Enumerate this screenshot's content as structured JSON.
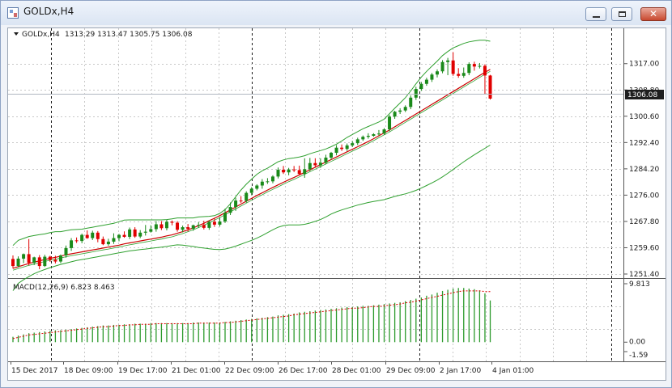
{
  "window": {
    "title": "GOLDx,H4"
  },
  "main_panel": {
    "info_prefix": "GOLDx,H4",
    "ohlc": "1313.29 1313.47 1305.75 1306.08",
    "current_price": "1306.08",
    "price_ticks": [
      "1317.00",
      "1308.80",
      "1300.60",
      "1292.40",
      "1284.20",
      "1276.00",
      "1267.80",
      "1259.60",
      "1251.40"
    ]
  },
  "macd_panel": {
    "label": "MACD(12,26,9) 6.823 8.463",
    "ticks": [
      "9.813",
      "0.00",
      "-1.59"
    ]
  },
  "time_axis": {
    "labels": [
      "15 Dec 2017",
      "18 Dec 09:00",
      "19 Dec 17:00",
      "21 Dec 01:00",
      "22 Dec 09:00",
      "26 Dec 17:00",
      "28 Dec 01:00",
      "29 Dec 09:00",
      "2 Jan 17:00",
      "4 Jan 01:00"
    ]
  },
  "colors": {
    "bull": "#1a8a1a",
    "bear": "#e00000",
    "band": "#2fa02f",
    "ma": "#cc0000",
    "macd_hist": "#2c9a2c",
    "signal": "#e00000"
  },
  "chart_data": [
    {
      "type": "candlestick",
      "symbol": "GOLDx",
      "timeframe": "H4",
      "ylim": [
        1251.4,
        1325
      ],
      "ticks": [
        1317.0,
        1308.8,
        1300.6,
        1292.4,
        1284.2,
        1276.0,
        1267.8,
        1259.6,
        1251.4
      ],
      "candles": [
        {
          "o": 1256.1,
          "h": 1257.2,
          "c": 1253.9,
          "l": 1253.1
        },
        {
          "o": 1253.9,
          "h": 1256.9,
          "c": 1256.2,
          "l": 1253.5
        },
        {
          "o": 1256.2,
          "h": 1257.8,
          "c": 1257.6,
          "l": 1254.8
        },
        {
          "o": 1257.6,
          "h": 1262.3,
          "c": 1254.9,
          "l": 1254.1
        },
        {
          "o": 1254.9,
          "h": 1256.8,
          "c": 1256.6,
          "l": 1254.2
        },
        {
          "o": 1256.6,
          "h": 1257.3,
          "c": 1253.9,
          "l": 1252.9
        },
        {
          "o": 1253.9,
          "h": 1257.4,
          "c": 1256.8,
          "l": 1253.6
        },
        {
          "o": 1256.8,
          "h": 1257.1,
          "c": 1255.8,
          "l": 1255.2
        },
        {
          "o": 1255.8,
          "h": 1257.1,
          "c": 1255.3,
          "l": 1254.7
        },
        {
          "o": 1255.3,
          "h": 1257.5,
          "c": 1257.2,
          "l": 1254.8
        },
        {
          "o": 1257.2,
          "h": 1260.3,
          "c": 1259.5,
          "l": 1256.5
        },
        {
          "o": 1259.5,
          "h": 1262.6,
          "c": 1261.9,
          "l": 1258.6
        },
        {
          "o": 1261.9,
          "h": 1262.8,
          "c": 1261.7,
          "l": 1261.1
        },
        {
          "o": 1261.7,
          "h": 1264.0,
          "c": 1263.6,
          "l": 1261.0
        },
        {
          "o": 1263.6,
          "h": 1265.0,
          "c": 1262.6,
          "l": 1262.4
        },
        {
          "o": 1262.6,
          "h": 1264.9,
          "c": 1264.3,
          "l": 1262.0
        },
        {
          "o": 1264.3,
          "h": 1264.8,
          "c": 1262.3,
          "l": 1261.3
        },
        {
          "o": 1262.3,
          "h": 1263.1,
          "c": 1260.7,
          "l": 1260.4
        },
        {
          "o": 1260.7,
          "h": 1262.4,
          "c": 1261.5,
          "l": 1260.2
        },
        {
          "o": 1261.5,
          "h": 1264.1,
          "c": 1262.6,
          "l": 1260.8
        },
        {
          "o": 1262.6,
          "h": 1263.9,
          "c": 1263.6,
          "l": 1261.6
        },
        {
          "o": 1263.6,
          "h": 1264.7,
          "c": 1263.0,
          "l": 1262.7
        },
        {
          "o": 1263.0,
          "h": 1265.9,
          "c": 1265.3,
          "l": 1262.3
        },
        {
          "o": 1265.3,
          "h": 1266.0,
          "c": 1263.1,
          "l": 1262.7
        },
        {
          "o": 1263.1,
          "h": 1265.1,
          "c": 1264.3,
          "l": 1262.6
        },
        {
          "o": 1264.3,
          "h": 1266.7,
          "c": 1264.6,
          "l": 1263.4
        },
        {
          "o": 1264.6,
          "h": 1266.6,
          "c": 1265.4,
          "l": 1264.3
        },
        {
          "o": 1265.4,
          "h": 1267.9,
          "c": 1266.9,
          "l": 1264.6
        },
        {
          "o": 1266.9,
          "h": 1267.9,
          "c": 1265.7,
          "l": 1265.1
        },
        {
          "o": 1265.7,
          "h": 1268.3,
          "c": 1267.7,
          "l": 1265.0
        },
        {
          "o": 1267.7,
          "h": 1268.1,
          "c": 1267.4,
          "l": 1266.6
        },
        {
          "o": 1267.4,
          "h": 1267.9,
          "c": 1265.2,
          "l": 1264.6
        },
        {
          "o": 1265.2,
          "h": 1266.5,
          "c": 1266.0,
          "l": 1264.4
        },
        {
          "o": 1266.0,
          "h": 1267.0,
          "c": 1265.5,
          "l": 1264.7
        },
        {
          "o": 1265.5,
          "h": 1266.8,
          "c": 1266.6,
          "l": 1264.9
        },
        {
          "o": 1266.6,
          "h": 1267.6,
          "c": 1266.7,
          "l": 1265.8
        },
        {
          "o": 1266.7,
          "h": 1268.0,
          "c": 1265.8,
          "l": 1265.3
        },
        {
          "o": 1265.8,
          "h": 1268.1,
          "c": 1267.7,
          "l": 1265.2
        },
        {
          "o": 1267.7,
          "h": 1268.8,
          "c": 1266.8,
          "l": 1266.1
        },
        {
          "o": 1266.8,
          "h": 1269.1,
          "c": 1267.8,
          "l": 1266.2
        },
        {
          "o": 1267.8,
          "h": 1271.8,
          "c": 1270.5,
          "l": 1267.3
        },
        {
          "o": 1270.5,
          "h": 1273.7,
          "c": 1272.3,
          "l": 1269.8
        },
        {
          "o": 1272.3,
          "h": 1275.2,
          "c": 1274.3,
          "l": 1271.1
        },
        {
          "o": 1274.3,
          "h": 1275.7,
          "c": 1274.2,
          "l": 1273.6
        },
        {
          "o": 1274.2,
          "h": 1277.2,
          "c": 1276.7,
          "l": 1273.6
        },
        {
          "o": 1276.7,
          "h": 1278.5,
          "c": 1278.0,
          "l": 1276.0
        },
        {
          "o": 1278.0,
          "h": 1279.4,
          "c": 1279.0,
          "l": 1277.5
        },
        {
          "o": 1279.0,
          "h": 1281.0,
          "c": 1280.2,
          "l": 1278.0
        },
        {
          "o": 1280.2,
          "h": 1281.3,
          "c": 1280.3,
          "l": 1279.5
        },
        {
          "o": 1280.3,
          "h": 1282.2,
          "c": 1281.8,
          "l": 1279.7
        },
        {
          "o": 1281.8,
          "h": 1284.6,
          "c": 1283.9,
          "l": 1281.2
        },
        {
          "o": 1283.9,
          "h": 1285.1,
          "c": 1283.1,
          "l": 1282.6
        },
        {
          "o": 1283.1,
          "h": 1284.5,
          "c": 1284.0,
          "l": 1282.2
        },
        {
          "o": 1284.0,
          "h": 1285.1,
          "c": 1283.8,
          "l": 1283.2
        },
        {
          "o": 1283.8,
          "h": 1285.2,
          "c": 1282.6,
          "l": 1282.2
        },
        {
          "o": 1282.6,
          "h": 1287.5,
          "c": 1284.1,
          "l": 1281.4
        },
        {
          "o": 1284.1,
          "h": 1287.6,
          "c": 1286.0,
          "l": 1283.5
        },
        {
          "o": 1286.0,
          "h": 1287.5,
          "c": 1285.3,
          "l": 1284.7
        },
        {
          "o": 1285.3,
          "h": 1287.5,
          "c": 1286.1,
          "l": 1284.5
        },
        {
          "o": 1286.1,
          "h": 1288.6,
          "c": 1287.7,
          "l": 1285.6
        },
        {
          "o": 1287.7,
          "h": 1289.5,
          "c": 1289.2,
          "l": 1287.1
        },
        {
          "o": 1289.2,
          "h": 1291.6,
          "c": 1290.8,
          "l": 1288.4
        },
        {
          "o": 1290.8,
          "h": 1291.8,
          "c": 1290.4,
          "l": 1289.8
        },
        {
          "o": 1290.4,
          "h": 1292.1,
          "c": 1291.5,
          "l": 1289.8
        },
        {
          "o": 1291.5,
          "h": 1292.9,
          "c": 1292.2,
          "l": 1291.0
        },
        {
          "o": 1292.2,
          "h": 1293.9,
          "c": 1293.4,
          "l": 1291.6
        },
        {
          "o": 1293.4,
          "h": 1294.6,
          "c": 1294.2,
          "l": 1292.9
        },
        {
          "o": 1294.2,
          "h": 1295.3,
          "c": 1294.5,
          "l": 1293.6
        },
        {
          "o": 1294.5,
          "h": 1295.3,
          "c": 1295.0,
          "l": 1294.2
        },
        {
          "o": 1295.0,
          "h": 1296.3,
          "c": 1295.2,
          "l": 1294.6
        },
        {
          "o": 1295.2,
          "h": 1296.9,
          "c": 1296.5,
          "l": 1294.8
        },
        {
          "o": 1296.5,
          "h": 1301.0,
          "c": 1300.5,
          "l": 1295.9
        },
        {
          "o": 1300.5,
          "h": 1302.3,
          "c": 1302.0,
          "l": 1299.8
        },
        {
          "o": 1302.0,
          "h": 1303.1,
          "c": 1302.4,
          "l": 1301.3
        },
        {
          "o": 1302.4,
          "h": 1304.0,
          "c": 1303.5,
          "l": 1301.9
        },
        {
          "o": 1303.5,
          "h": 1307.1,
          "c": 1306.4,
          "l": 1302.8
        },
        {
          "o": 1306.4,
          "h": 1309.8,
          "c": 1309.1,
          "l": 1305.7
        },
        {
          "o": 1309.1,
          "h": 1311.3,
          "c": 1310.7,
          "l": 1308.5
        },
        {
          "o": 1310.7,
          "h": 1312.6,
          "c": 1312.0,
          "l": 1310.1
        },
        {
          "o": 1312.0,
          "h": 1314.1,
          "c": 1313.6,
          "l": 1311.3
        },
        {
          "o": 1313.6,
          "h": 1315.2,
          "c": 1314.6,
          "l": 1312.7
        },
        {
          "o": 1314.6,
          "h": 1318.1,
          "c": 1317.5,
          "l": 1314.0
        },
        {
          "o": 1317.5,
          "h": 1318.8,
          "c": 1318.0,
          "l": 1313.4
        },
        {
          "o": 1318.0,
          "h": 1320.6,
          "c": 1313.8,
          "l": 1313.2
        },
        {
          "o": 1313.8,
          "h": 1315.6,
          "c": 1313.2,
          "l": 1312.6
        },
        {
          "o": 1313.2,
          "h": 1315.8,
          "c": 1314.1,
          "l": 1312.6
        },
        {
          "o": 1314.1,
          "h": 1317.4,
          "c": 1316.9,
          "l": 1313.4
        },
        {
          "o": 1316.9,
          "h": 1317.6,
          "c": 1316.1,
          "l": 1314.8
        },
        {
          "o": 1316.1,
          "h": 1317.2,
          "c": 1316.3,
          "l": 1315.5
        },
        {
          "o": 1316.3,
          "h": 1316.8,
          "c": 1313.3,
          "l": 1307.4
        },
        {
          "o": 1313.3,
          "h": 1313.5,
          "c": 1306.1,
          "l": 1305.8
        }
      ],
      "bollinger": {
        "upper": [
          1260.3,
          1261.9,
          1262.5,
          1263.1,
          1263.4,
          1263.7,
          1263.9,
          1264.3,
          1264.6,
          1264.6,
          1264.9,
          1265.2,
          1265.3,
          1265.4,
          1265.7,
          1266.0,
          1266.3,
          1266.6,
          1266.9,
          1267.2,
          1267.7,
          1268.2,
          1268.3,
          1268.3,
          1268.3,
          1268.3,
          1268.3,
          1268.3,
          1268.3,
          1268.4,
          1268.6,
          1268.9,
          1268.9,
          1268.9,
          1268.9,
          1269.2,
          1269.3,
          1269.4,
          1269.6,
          1270.3,
          1271.5,
          1273.3,
          1275.5,
          1277.6,
          1279.4,
          1281.0,
          1282.5,
          1283.6,
          1284.4,
          1285.4,
          1286.4,
          1287.0,
          1287.4,
          1287.6,
          1287.9,
          1288.3,
          1288.9,
          1289.4,
          1289.9,
          1290.4,
          1291.1,
          1291.9,
          1292.9,
          1294.0,
          1294.9,
          1295.8,
          1296.7,
          1297.4,
          1298.1,
          1298.8,
          1299.7,
          1301.4,
          1303.1,
          1304.7,
          1306.4,
          1308.5,
          1310.7,
          1312.8,
          1314.6,
          1316.2,
          1317.8,
          1319.5,
          1320.8,
          1321.9,
          1322.6,
          1323.3,
          1323.8,
          1324.1,
          1324.3,
          1324.3,
          1324.0
        ],
        "lower": [
          1246.2,
          1248.5,
          1249.6,
          1250.6,
          1251.5,
          1252.2,
          1252.8,
          1253.4,
          1253.9,
          1254.4,
          1254.8,
          1255.2,
          1255.6,
          1255.9,
          1256.2,
          1256.5,
          1256.8,
          1257.1,
          1257.4,
          1257.7,
          1258.0,
          1258.3,
          1258.6,
          1258.8,
          1259.0,
          1259.2,
          1259.4,
          1259.6,
          1259.8,
          1260.0,
          1260.3,
          1260.5,
          1260.4,
          1260.2,
          1260.0,
          1259.7,
          1259.5,
          1259.3,
          1259.1,
          1259.0,
          1259.2,
          1259.6,
          1260.1,
          1260.7,
          1261.3,
          1261.9,
          1262.6,
          1263.4,
          1264.3,
          1265.2,
          1266.0,
          1266.5,
          1266.7,
          1266.7,
          1266.7,
          1266.9,
          1267.3,
          1267.8,
          1268.4,
          1269.2,
          1270.1,
          1270.8,
          1271.4,
          1271.9,
          1272.4,
          1272.9,
          1273.3,
          1273.7,
          1274.0,
          1274.3,
          1274.6,
          1275.1,
          1275.6,
          1276.0,
          1276.4,
          1276.9,
          1277.5,
          1278.2,
          1279.0,
          1279.8,
          1280.7,
          1281.7,
          1282.8,
          1284.0,
          1285.2,
          1286.4,
          1287.5,
          1288.6,
          1289.6,
          1290.6,
          1291.6
        ]
      },
      "moving_average": [
        1253.2,
        1253.7,
        1254.2,
        1254.7,
        1255.1,
        1255.5,
        1255.9,
        1256.3,
        1256.6,
        1257.0,
        1257.4,
        1257.7,
        1258.0,
        1258.3,
        1258.6,
        1258.9,
        1259.2,
        1259.5,
        1259.8,
        1260.1,
        1260.4,
        1260.8,
        1261.1,
        1261.4,
        1261.7,
        1262.0,
        1262.3,
        1262.6,
        1262.9,
        1263.3,
        1263.6,
        1264.1,
        1264.6,
        1265.2,
        1265.8,
        1266.5,
        1267.2,
        1268.0,
        1268.8,
        1269.6,
        1270.5,
        1271.4,
        1272.3,
        1273.2,
        1274.1,
        1275.0,
        1275.9,
        1276.7,
        1277.6,
        1278.4,
        1279.2,
        1280.0,
        1280.8,
        1281.5,
        1282.3,
        1283.1,
        1283.9,
        1284.7,
        1285.5,
        1286.3,
        1287.1,
        1287.9,
        1288.7,
        1289.5,
        1290.3,
        1291.1,
        1291.9,
        1292.7,
        1293.6,
        1294.5,
        1295.4,
        1296.3,
        1297.3,
        1298.3,
        1299.3,
        1300.3,
        1301.3,
        1302.3,
        1303.3,
        1304.3,
        1305.3,
        1306.3,
        1307.3,
        1308.3,
        1309.3,
        1310.3,
        1311.3,
        1312.3,
        1313.3,
        1314.3,
        1315.2
      ]
    },
    {
      "type": "bar",
      "indicator": "MACD(12,26,9)",
      "macd": 6.823,
      "signal": 8.463,
      "ylim": [
        -1.59,
        9.813
      ],
      "histogram": [
        0.9,
        1.1,
        1.3,
        1.5,
        1.6,
        1.7,
        1.8,
        1.9,
        2.0,
        2.0,
        2.1,
        2.2,
        2.3,
        2.4,
        2.5,
        2.6,
        2.7,
        2.8,
        2.8,
        2.9,
        2.9,
        3.0,
        3.0,
        3.1,
        3.1,
        3.1,
        3.2,
        3.2,
        3.2,
        3.2,
        3.2,
        3.2,
        3.2,
        3.2,
        3.3,
        3.3,
        3.3,
        3.3,
        3.3,
        3.3,
        3.4,
        3.5,
        3.6,
        3.7,
        3.8,
        3.9,
        4.0,
        4.1,
        4.2,
        4.3,
        4.5,
        4.6,
        4.7,
        4.8,
        5.0,
        5.1,
        5.2,
        5.3,
        5.4,
        5.5,
        5.6,
        5.7,
        5.8,
        5.9,
        5.9,
        6.0,
        6.1,
        6.1,
        6.2,
        6.3,
        6.4,
        6.5,
        6.6,
        6.7,
        6.9,
        7.1,
        7.3,
        7.5,
        7.8,
        8.0,
        8.3,
        8.6,
        8.8,
        9.0,
        9.1,
        9.1,
        9.0,
        8.9,
        8.7,
        8.2,
        7.0
      ],
      "signal_line": [
        0.6,
        0.8,
        1.0,
        1.2,
        1.3,
        1.4,
        1.5,
        1.6,
        1.7,
        1.8,
        1.9,
        2.0,
        2.1,
        2.2,
        2.3,
        2.4,
        2.5,
        2.6,
        2.6,
        2.7,
        2.8,
        2.8,
        2.9,
        2.9,
        3.0,
        3.0,
        3.0,
        3.1,
        3.1,
        3.1,
        3.1,
        3.1,
        3.1,
        3.1,
        3.1,
        3.2,
        3.2,
        3.2,
        3.2,
        3.2,
        3.3,
        3.3,
        3.4,
        3.5,
        3.6,
        3.7,
        3.8,
        3.9,
        4.0,
        4.1,
        4.2,
        4.3,
        4.4,
        4.6,
        4.7,
        4.8,
        4.9,
        5.0,
        5.1,
        5.2,
        5.3,
        5.4,
        5.5,
        5.6,
        5.7,
        5.7,
        5.8,
        5.9,
        6.0,
        6.0,
        6.1,
        6.2,
        6.3,
        6.4,
        6.6,
        6.7,
        6.9,
        7.1,
        7.3,
        7.5,
        7.7,
        7.9,
        8.1,
        8.3,
        8.5,
        8.6,
        8.6,
        8.6,
        8.6,
        8.5,
        8.5
      ]
    }
  ]
}
